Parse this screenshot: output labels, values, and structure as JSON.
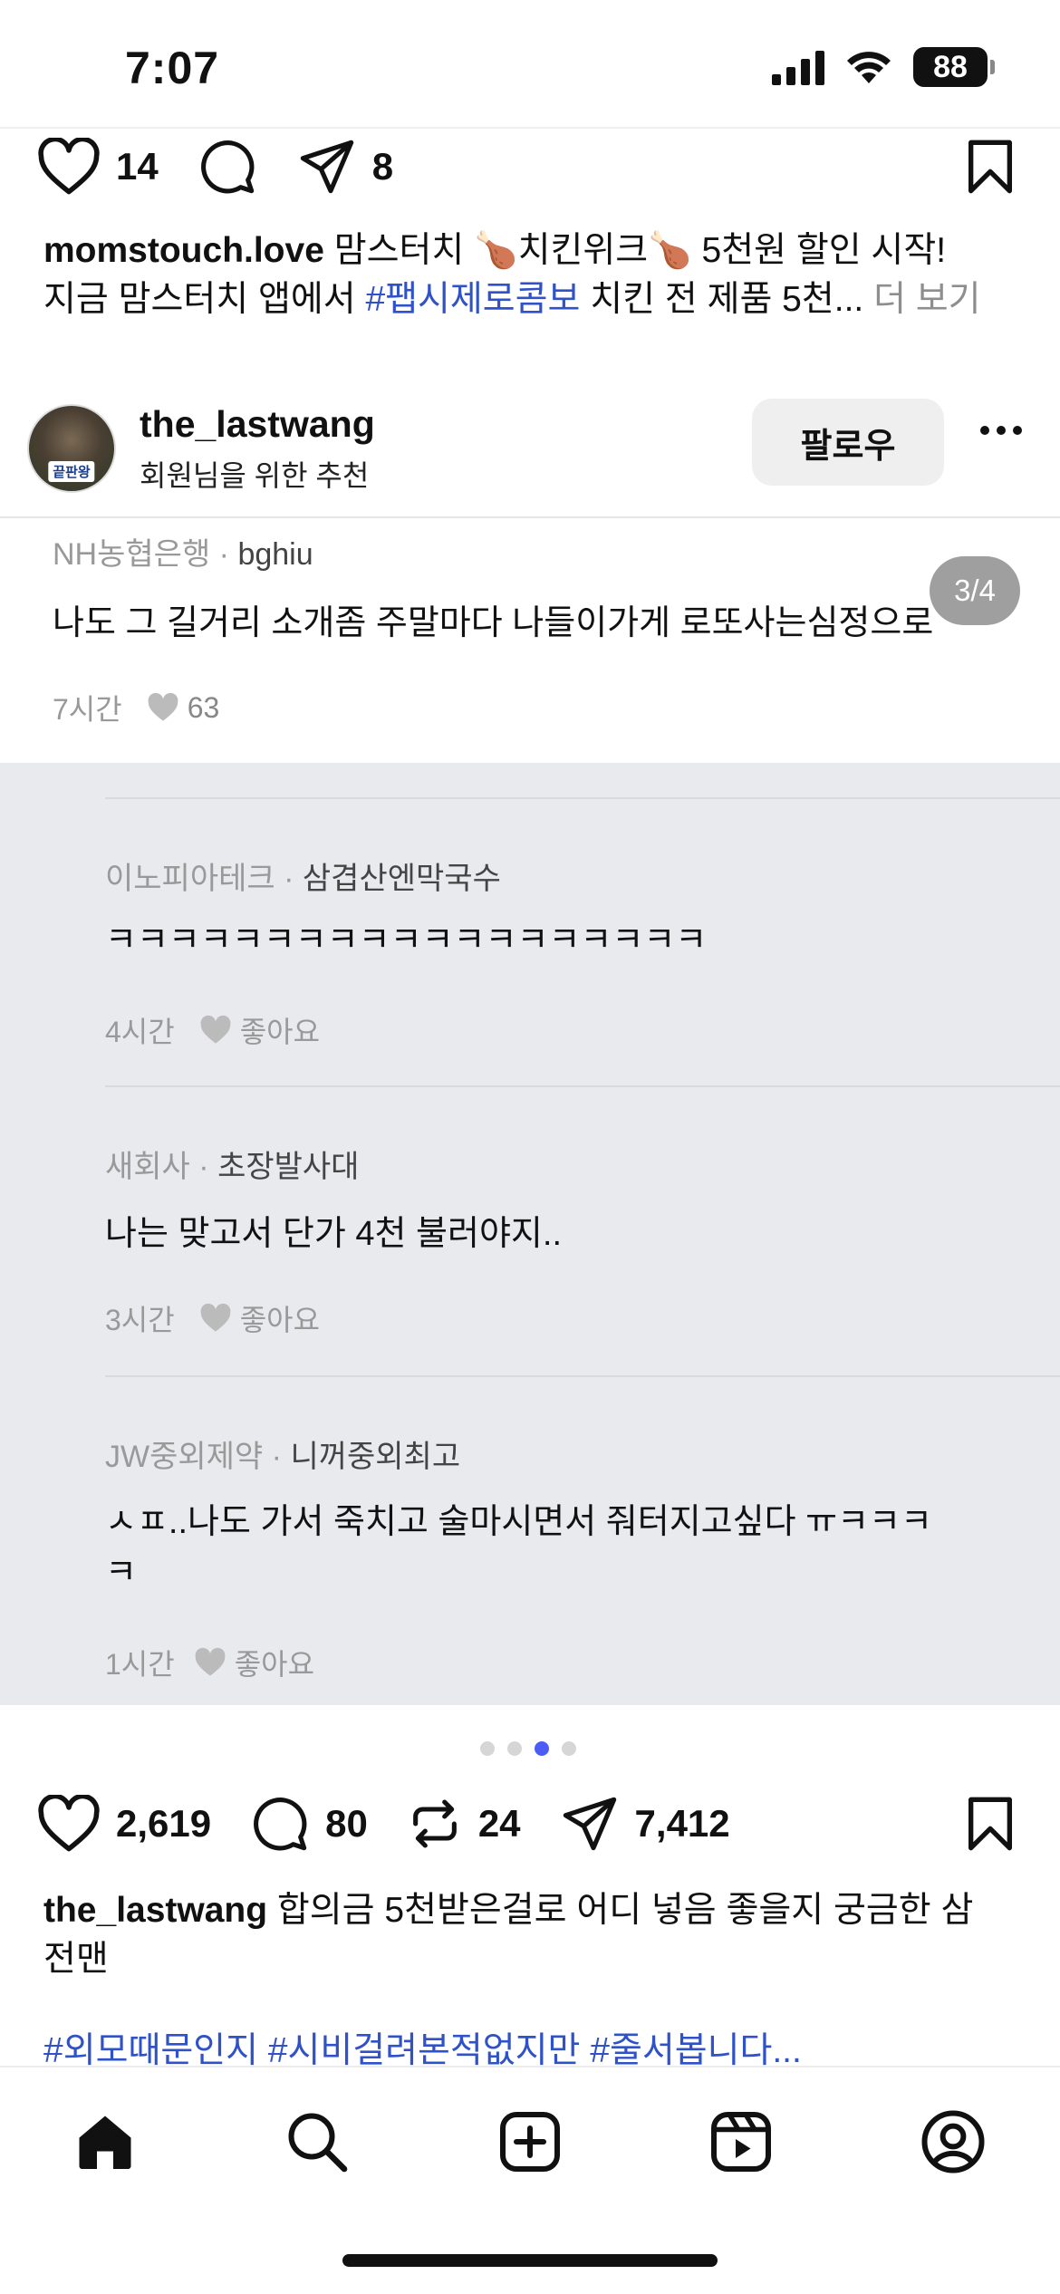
{
  "status_bar": {
    "time": "7:07",
    "battery": "88"
  },
  "post1": {
    "likes": "14",
    "shares": "8",
    "caption_user": "momstouch.love",
    "caption_line1_rest": " 맘스터치 🍗치킨위크🍗 5천원 할인 시작!",
    "caption_line2_prefix": "지금 맘스터치 앱에서 ",
    "caption_hashtag": "#팹시제로콤보",
    "caption_line2_suffix": " 치킨 전 제품 5천...",
    "more": " 더 보기"
  },
  "post2": {
    "username": "the_lastwang",
    "subtitle": "회원님을 위한 추천",
    "avatar_text": "끝판왕",
    "follow_label": "팔로우",
    "page_indicator": "3/4",
    "comments": [
      {
        "company": "NH농협은행",
        "nick": "bghiu",
        "text": "나도 그 길거리 소개좀 주말마다 나들이가게 로또사는심정으로",
        "time": "7시간",
        "likes": "63"
      },
      {
        "company": "이노피아테크",
        "nick": "삼겹산엔막국수",
        "text": "ㅋㅋㅋㅋㅋㅋㅋㅋㅋㅋㅋㅋㅋㅋㅋㅋㅋㅋㅋ",
        "time": "4시간",
        "likes": "좋아요"
      },
      {
        "company": "새회사",
        "nick": "초장발사대",
        "text": "나는 맞고서 단가 4천 불러야지..",
        "time": "3시간",
        "likes": "좋아요"
      },
      {
        "company": "JW중외제약",
        "nick": "니꺼중외최고",
        "text": "ㅅㅍ..나도 가서 죽치고 술마시면서 줘터지고싶다 ㅠㅋㅋㅋ",
        "text2": "ㅋ",
        "time": "1시간",
        "likes": "좋아요"
      }
    ],
    "likes": "2,619",
    "comments_count": "80",
    "reposts": "24",
    "shares": "7,412",
    "caption_user": "the_lastwang",
    "caption_text": " 합의금 5천받은걸로 어디 넣음 좋을지 궁금한 삼",
    "caption_text2": "전맨",
    "hashtags": "#외모때문인지 #시비걸려본적없지만 #줄서봅니다..."
  },
  "nav": {
    "icons": [
      "home-icon",
      "search-icon",
      "create-icon",
      "reels-icon",
      "profile-icon"
    ]
  },
  "colors": {
    "link": "#2f52c8",
    "active_dot": "#4c5df5",
    "image_bg": "#e9eaee"
  }
}
